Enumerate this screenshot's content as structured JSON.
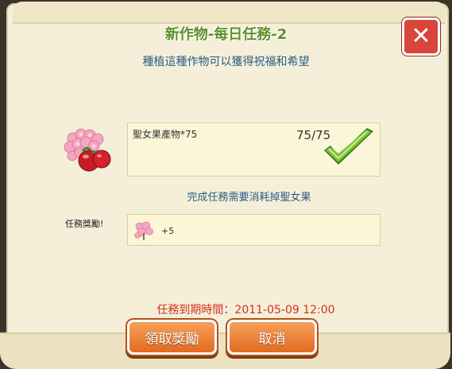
{
  "dialog": {
    "title": "新作物-每日任務-2",
    "subtitle": "種植這種作物可以獲得祝福和希望",
    "close_label": "✕"
  },
  "task": {
    "name": "聖女果產物*75",
    "count": "75/75",
    "icon": "cherry-tomato-blossom-icon",
    "completed": true
  },
  "consume_note": "完成任務需要消耗掉聖女果",
  "reward": {
    "label": "任務獎勵!",
    "icon": "blossom-icon",
    "amount": "+5"
  },
  "expire_text": "任務到期時間：2011-05-09 12:00",
  "buttons": {
    "claim": "領取獎勵",
    "cancel": "取消"
  },
  "colors": {
    "title": "#5f8f2a",
    "info_text": "#2b5c86",
    "expire_text": "#d62e1f",
    "button": "#e26a1f",
    "close_button": "#d8453a"
  }
}
